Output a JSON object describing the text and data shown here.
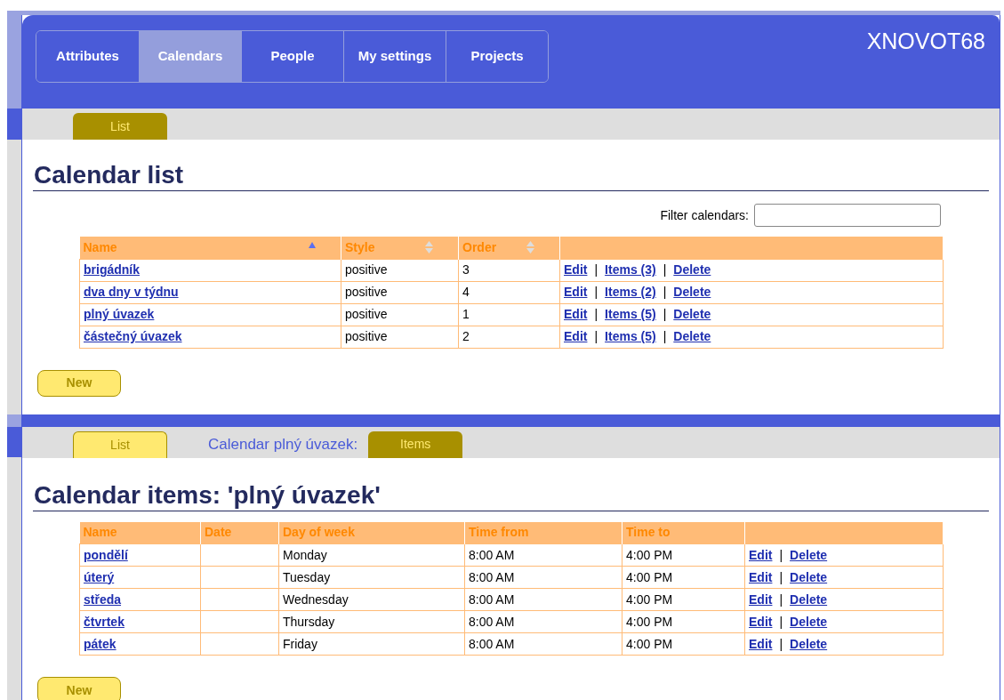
{
  "user": "XNOVOT68",
  "nav": [
    {
      "label": "Attributes",
      "selected": false
    },
    {
      "label": "Calendars",
      "selected": true
    },
    {
      "label": "People",
      "selected": false
    },
    {
      "label": "My settings",
      "selected": false
    },
    {
      "label": "Projects",
      "selected": false
    }
  ],
  "sections": [
    {
      "tabs": [
        {
          "kind": "tab",
          "label": "List",
          "selected": true
        }
      ],
      "heading": "Calendar list",
      "filter": {
        "label": "Filter calendars:"
      },
      "table": {
        "columns": [
          {
            "label": "Name",
            "sorted": true
          },
          {
            "label": "Style",
            "sorted": false
          },
          {
            "label": "Order",
            "sorted": false
          },
          {}
        ],
        "rows": [
          {
            "cells": [
              "brigádník",
              "positive",
              "3"
            ],
            "actions": [
              {
                "kind": "link",
                "label": "Edit"
              },
              {
                "kind": "separator",
                "label": "|"
              },
              {
                "kind": "link",
                "label": "Items (3)"
              },
              {
                "kind": "separator",
                "label": "|"
              },
              {
                "kind": "link",
                "label": "Delete"
              }
            ]
          },
          {
            "cells": [
              "dva dny v týdnu",
              "positive",
              "4"
            ],
            "actions": [
              {
                "kind": "link",
                "label": "Edit"
              },
              {
                "kind": "separator",
                "label": "|"
              },
              {
                "kind": "link",
                "label": "Items (2)"
              },
              {
                "kind": "separator",
                "label": "|"
              },
              {
                "kind": "link",
                "label": "Delete"
              }
            ]
          },
          {
            "cells": [
              "plný úvazek",
              "positive",
              "1"
            ],
            "actions": [
              {
                "kind": "link",
                "label": "Edit"
              },
              {
                "kind": "separator",
                "label": "|"
              },
              {
                "kind": "link",
                "label": "Items (5)"
              },
              {
                "kind": "separator",
                "label": "|"
              },
              {
                "kind": "link",
                "label": "Delete"
              }
            ]
          },
          {
            "cells": [
              "částečný úvazek",
              "positive",
              "2"
            ],
            "actions": [
              {
                "kind": "link",
                "label": "Edit"
              },
              {
                "kind": "separator",
                "label": "|"
              },
              {
                "kind": "link",
                "label": "Items (5)"
              },
              {
                "kind": "separator",
                "label": "|"
              },
              {
                "kind": "link",
                "label": "Delete"
              }
            ]
          }
        ]
      },
      "new_button": "New"
    },
    {
      "tabs": [
        {
          "kind": "tab",
          "label": "List",
          "selected": false
        },
        {
          "kind": "caption",
          "label": "Calendar plný úvazek:"
        },
        {
          "kind": "tab",
          "label": "Items",
          "selected": true
        }
      ],
      "heading": "Calendar items: 'plný úvazek'",
      "table": {
        "columns": [
          {
            "label": "Name"
          },
          {
            "label": "Date"
          },
          {
            "label": "Day of week"
          },
          {
            "label": "Time from"
          },
          {
            "label": "Time to"
          },
          {}
        ],
        "rows": [
          {
            "cells": [
              "pondělí",
              "",
              "Monday",
              "8:00 AM",
              "4:00 PM"
            ],
            "actions": [
              {
                "kind": "link",
                "label": "Edit"
              },
              {
                "kind": "separator",
                "label": "|"
              },
              {
                "kind": "link",
                "label": "Delete"
              }
            ]
          },
          {
            "cells": [
              "úterý",
              "",
              "Tuesday",
              "8:00 AM",
              "4:00 PM"
            ],
            "actions": [
              {
                "kind": "link",
                "label": "Edit"
              },
              {
                "kind": "separator",
                "label": "|"
              },
              {
                "kind": "link",
                "label": "Delete"
              }
            ]
          },
          {
            "cells": [
              "středa",
              "",
              "Wednesday",
              "8:00 AM",
              "4:00 PM"
            ],
            "actions": [
              {
                "kind": "link",
                "label": "Edit"
              },
              {
                "kind": "separator",
                "label": "|"
              },
              {
                "kind": "link",
                "label": "Delete"
              }
            ]
          },
          {
            "cells": [
              "čtvrtek",
              "",
              "Thursday",
              "8:00 AM",
              "4:00 PM"
            ],
            "actions": [
              {
                "kind": "link",
                "label": "Edit"
              },
              {
                "kind": "separator",
                "label": "|"
              },
              {
                "kind": "link",
                "label": "Delete"
              }
            ]
          },
          {
            "cells": [
              "pátek",
              "",
              "Friday",
              "8:00 AM",
              "4:00 PM"
            ],
            "actions": [
              {
                "kind": "link",
                "label": "Edit"
              },
              {
                "kind": "separator",
                "label": "|"
              },
              {
                "kind": "link",
                "label": "Delete"
              }
            ]
          }
        ]
      },
      "new_button": "New"
    }
  ]
}
